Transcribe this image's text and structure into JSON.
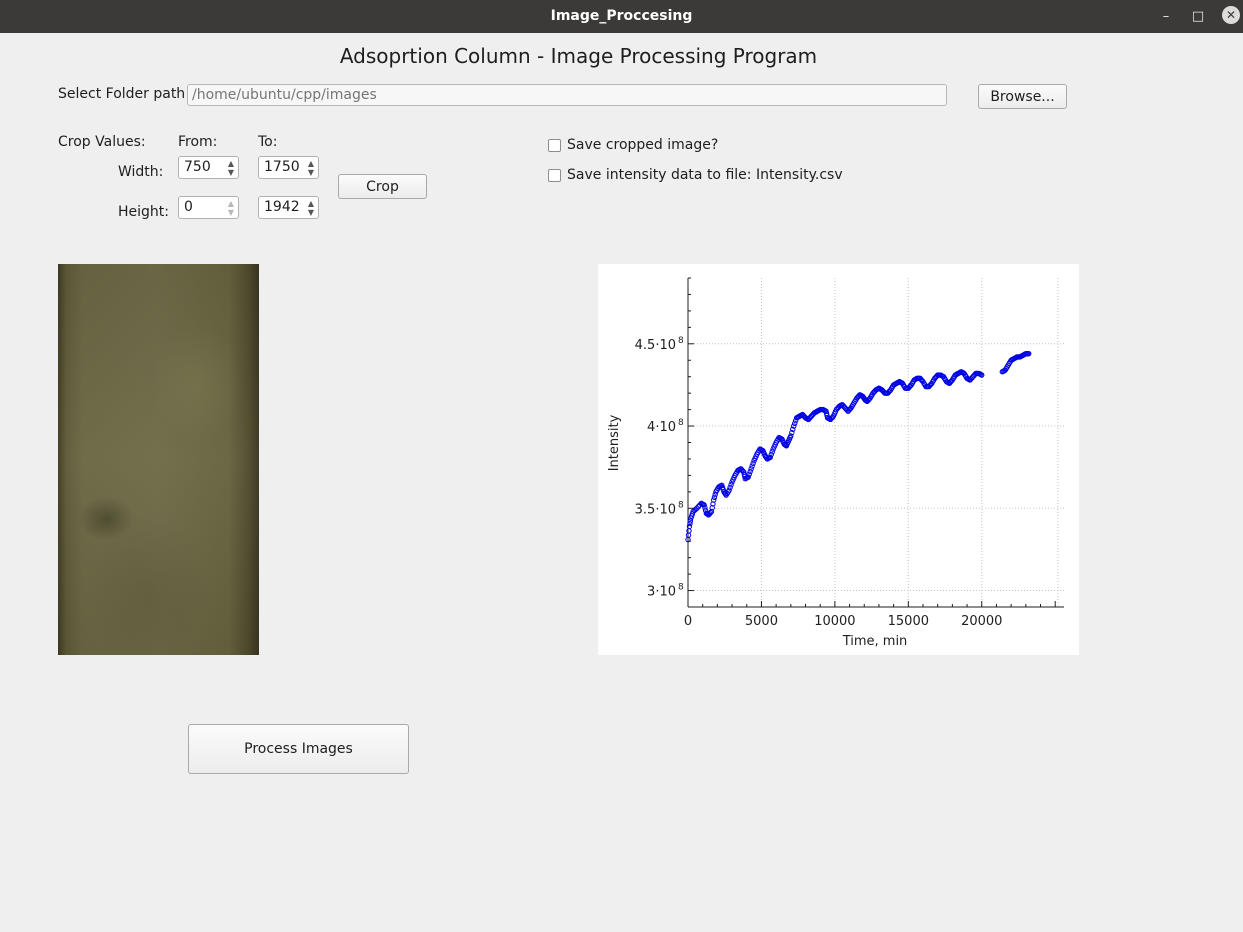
{
  "window": {
    "title": "Image_Proccesing",
    "minimize_icon": "minimize-icon",
    "maximize_icon": "maximize-icon",
    "close_icon": "close-icon"
  },
  "heading": "Adsoprtion Column - Image Processing Program",
  "folder": {
    "label": "Select Folder path",
    "placeholder": "/home/ubuntu/cpp/images",
    "browse_label": "Browse..."
  },
  "crop": {
    "label": "Crop Values:",
    "from_label": "From:",
    "to_label": "To:",
    "width_label": "Width:",
    "height_label": "Height:",
    "width_from": "750",
    "width_to": "1750",
    "height_from": "0",
    "height_to": "1942",
    "button_label": "Crop"
  },
  "options": {
    "save_cropped_label": "Save cropped image?",
    "save_cropped_checked": false,
    "save_intensity_label": "Save intensity data to file: Intensity.csv",
    "save_intensity_checked": false
  },
  "process_button_label": "Process Images",
  "colors": {
    "titlebar": "#3b3a38",
    "window_bg": "#efefef",
    "series": "#0000e6"
  },
  "chart_data": {
    "type": "scatter",
    "xlabel": "Time, min",
    "ylabel": "Intensity",
    "xlim": [
      0,
      25600
    ],
    "ylim": [
      290000000,
      490000000
    ],
    "x_ticks": [
      0,
      5000,
      10000,
      15000,
      20000
    ],
    "x_tick_labels": [
      "0",
      "5000",
      "10000",
      "15000",
      "20000"
    ],
    "y_ticks": [
      300000000,
      350000000,
      400000000,
      450000000
    ],
    "y_tick_labels": [
      {
        "mantissa": "3·10",
        "exp": "8"
      },
      {
        "mantissa": "3.5·10",
        "exp": "8"
      },
      {
        "mantissa": "4·10",
        "exp": "8"
      },
      {
        "mantissa": "4.5·10",
        "exp": "8"
      }
    ],
    "grid": true,
    "marker": "open-circle",
    "series": [
      {
        "color": "#0000e6",
        "points": [
          [
            0,
            331000000
          ],
          [
            100,
            339000000
          ],
          [
            200,
            344000000
          ],
          [
            350,
            348000000
          ],
          [
            600,
            350000000
          ],
          [
            900,
            353000000
          ],
          [
            1100,
            352000000
          ],
          [
            1250,
            347000000
          ],
          [
            1400,
            346000000
          ],
          [
            1600,
            348000000
          ],
          [
            1750,
            355000000
          ],
          [
            1900,
            360000000
          ],
          [
            2100,
            363000000
          ],
          [
            2300,
            364000000
          ],
          [
            2450,
            360000000
          ],
          [
            2600,
            358000000
          ],
          [
            2800,
            361000000
          ],
          [
            3000,
            366000000
          ],
          [
            3200,
            370000000
          ],
          [
            3400,
            373000000
          ],
          [
            3600,
            374000000
          ],
          [
            3800,
            372000000
          ],
          [
            3900,
            368000000
          ],
          [
            4100,
            369000000
          ],
          [
            4300,
            374000000
          ],
          [
            4500,
            379000000
          ],
          [
            4700,
            383000000
          ],
          [
            4900,
            386000000
          ],
          [
            5100,
            385000000
          ],
          [
            5250,
            382000000
          ],
          [
            5400,
            380000000
          ],
          [
            5600,
            381000000
          ],
          [
            5800,
            386000000
          ],
          [
            6000,
            390000000
          ],
          [
            6200,
            393000000
          ],
          [
            6400,
            392000000
          ],
          [
            6550,
            389000000
          ],
          [
            6700,
            388000000
          ],
          [
            6850,
            391000000
          ],
          [
            7000,
            394000000
          ],
          [
            7200,
            400000000
          ],
          [
            7400,
            405000000
          ],
          [
            7600,
            406000000
          ],
          [
            7800,
            407000000
          ],
          [
            8000,
            405000000
          ],
          [
            8200,
            404000000
          ],
          [
            8400,
            406000000
          ],
          [
            8600,
            408000000
          ],
          [
            8800,
            409000000
          ],
          [
            9000,
            410000000
          ],
          [
            9200,
            410000000
          ],
          [
            9400,
            409000000
          ],
          [
            9500,
            405000000
          ],
          [
            9700,
            404000000
          ],
          [
            9900,
            406000000
          ],
          [
            10100,
            410000000
          ],
          [
            10300,
            412000000
          ],
          [
            10500,
            413000000
          ],
          [
            10700,
            411000000
          ],
          [
            10900,
            409000000
          ],
          [
            11100,
            411000000
          ],
          [
            11300,
            414000000
          ],
          [
            11500,
            417000000
          ],
          [
            11700,
            419000000
          ],
          [
            11900,
            418000000
          ],
          [
            12050,
            416000000
          ],
          [
            12200,
            415000000
          ],
          [
            12400,
            417000000
          ],
          [
            12600,
            420000000
          ],
          [
            12800,
            422000000
          ],
          [
            13000,
            423000000
          ],
          [
            13200,
            422000000
          ],
          [
            13400,
            420000000
          ],
          [
            13600,
            420000000
          ],
          [
            13800,
            422000000
          ],
          [
            14000,
            425000000
          ],
          [
            14200,
            426000000
          ],
          [
            14400,
            427000000
          ],
          [
            14600,
            426000000
          ],
          [
            14800,
            423000000
          ],
          [
            15000,
            423000000
          ],
          [
            15200,
            425000000
          ],
          [
            15400,
            428000000
          ],
          [
            15600,
            429000000
          ],
          [
            15800,
            429000000
          ],
          [
            16000,
            427000000
          ],
          [
            16200,
            424000000
          ],
          [
            16400,
            424000000
          ],
          [
            16600,
            426000000
          ],
          [
            16800,
            429000000
          ],
          [
            17000,
            431000000
          ],
          [
            17200,
            431000000
          ],
          [
            17400,
            430000000
          ],
          [
            17600,
            427000000
          ],
          [
            17800,
            426000000
          ],
          [
            18000,
            428000000
          ],
          [
            18200,
            431000000
          ],
          [
            18400,
            432000000
          ],
          [
            18600,
            433000000
          ],
          [
            18800,
            432000000
          ],
          [
            19000,
            429000000
          ],
          [
            19200,
            428000000
          ],
          [
            19400,
            430000000
          ],
          [
            19600,
            432000000
          ],
          [
            19800,
            432000000
          ],
          [
            20000,
            431000000
          ],
          [
            21400,
            433000000
          ],
          [
            21600,
            434000000
          ],
          [
            21800,
            437000000
          ],
          [
            22000,
            440000000
          ],
          [
            22200,
            441000000
          ],
          [
            22400,
            442000000
          ],
          [
            22600,
            442000000
          ],
          [
            22800,
            443000000
          ],
          [
            23000,
            444000000
          ],
          [
            23200,
            444000000
          ]
        ]
      }
    ]
  }
}
